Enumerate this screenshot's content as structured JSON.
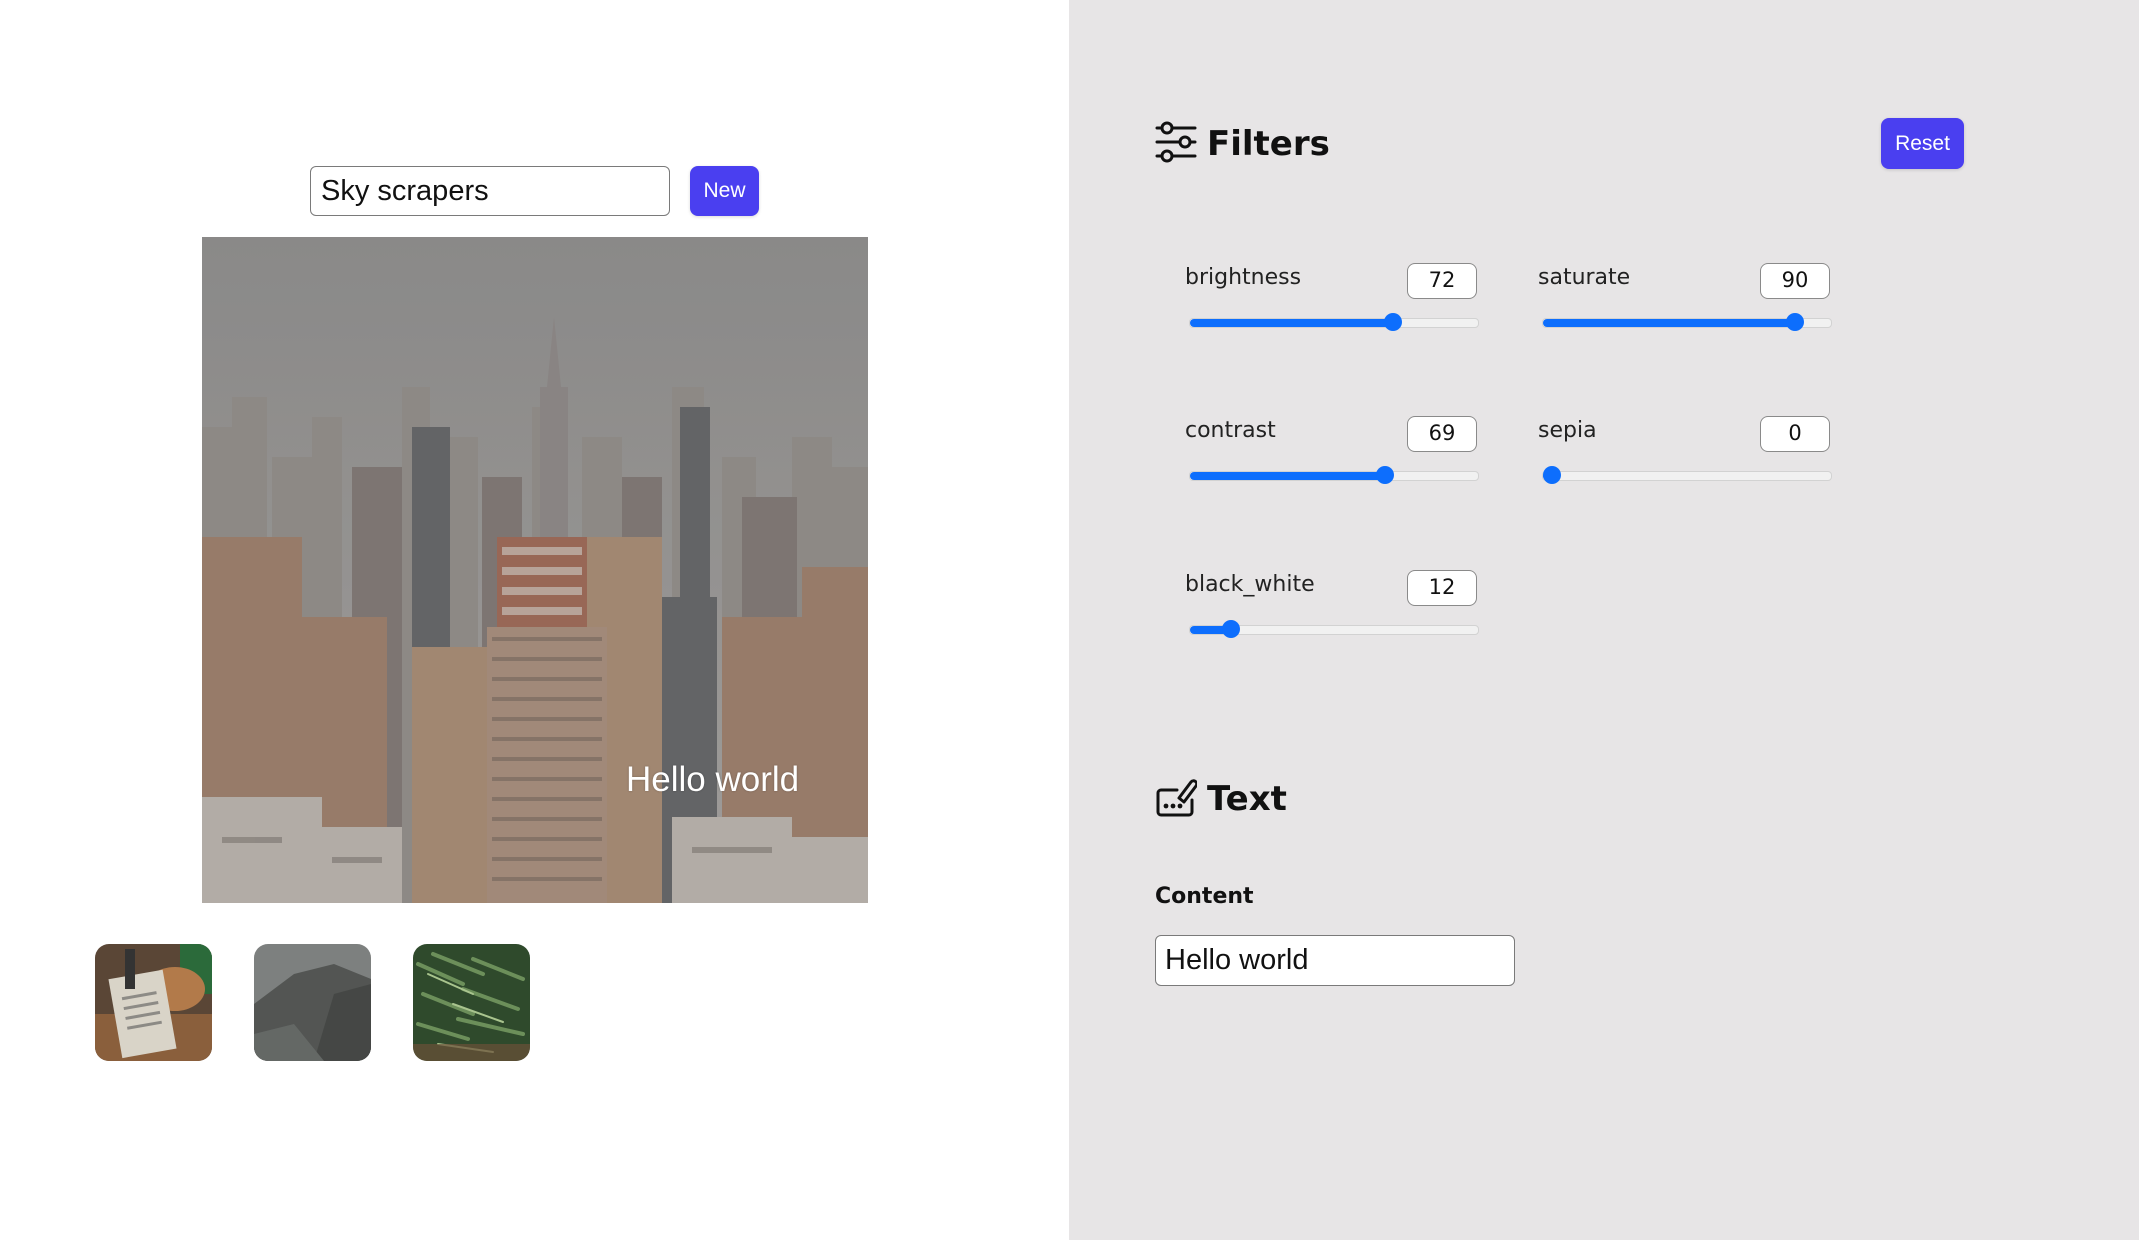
{
  "editor": {
    "search_value": "Sky scrapers",
    "new_label": "New",
    "overlay_text": "Hello world",
    "main_image": "city-skyline-photo",
    "thumbnails": [
      {
        "name": "thumbnail-desk-books"
      },
      {
        "name": "thumbnail-misty-cliffs"
      },
      {
        "name": "thumbnail-green-beans"
      }
    ]
  },
  "filters": {
    "title": "Filters",
    "icon": "sliders-icon",
    "reset_label": "Reset",
    "items": [
      {
        "label": "brightness",
        "value": "72",
        "level": 0.72
      },
      {
        "label": "saturate",
        "value": "90",
        "level": 0.9
      },
      {
        "label": "contrast",
        "value": "69",
        "level": 0.69
      },
      {
        "label": "sepia",
        "value": "0",
        "level": 0.0
      },
      {
        "label": "black_white",
        "value": "12",
        "level": 0.12
      }
    ]
  },
  "text_section": {
    "title": "Text",
    "icon": "paint-brush-icon",
    "content_label": "Content",
    "content_value": "Hello world"
  },
  "colors": {
    "accent_button": "#4a3ff0",
    "slider_blue": "#0d6efd",
    "panel_bg": "#e7e5e6"
  }
}
